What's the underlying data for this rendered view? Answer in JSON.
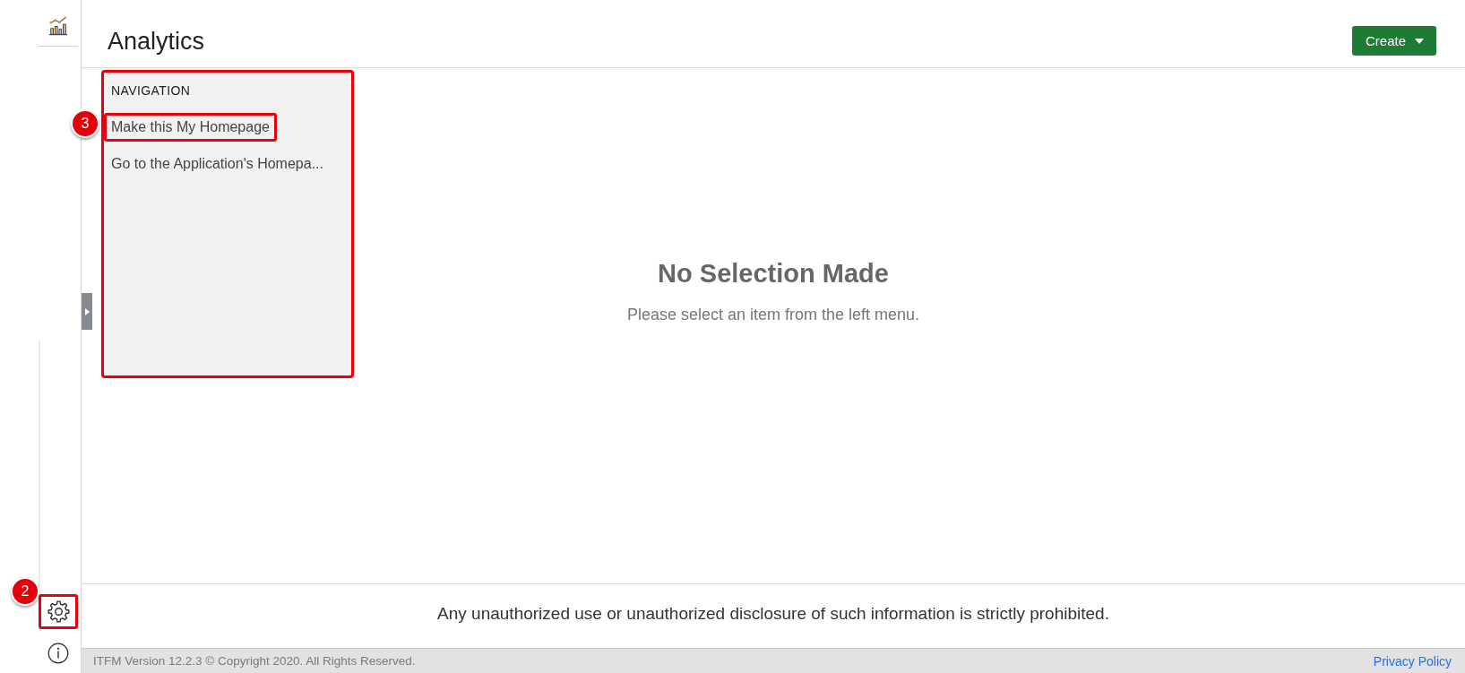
{
  "rail": {
    "items": [
      {
        "kind": "analytics"
      }
    ],
    "bottom_items": [
      {
        "kind": "settings",
        "highlighted": true,
        "callout": "2"
      },
      {
        "kind": "info",
        "highlighted": false
      }
    ]
  },
  "header": {
    "title": "Analytics",
    "create_button": {
      "label": "Create"
    }
  },
  "navigation": {
    "title": "NAVIGATION",
    "highlighted": true,
    "items": [
      {
        "label": "Make this My Homepage",
        "highlighted": true,
        "callout": "3"
      },
      {
        "label": "Go to the Application's Homepa...",
        "highlighted": false
      }
    ]
  },
  "empty_state": {
    "title": "No Selection Made",
    "message": "Please select an item from the left menu."
  },
  "notice": "Any unauthorized use or unauthorized disclosure of such information is strictly prohibited.",
  "footer": {
    "copyright": "ITFM Version 12.2.3 © Copyright 2020. All Rights Reserved.",
    "link": "Privacy Policy"
  }
}
